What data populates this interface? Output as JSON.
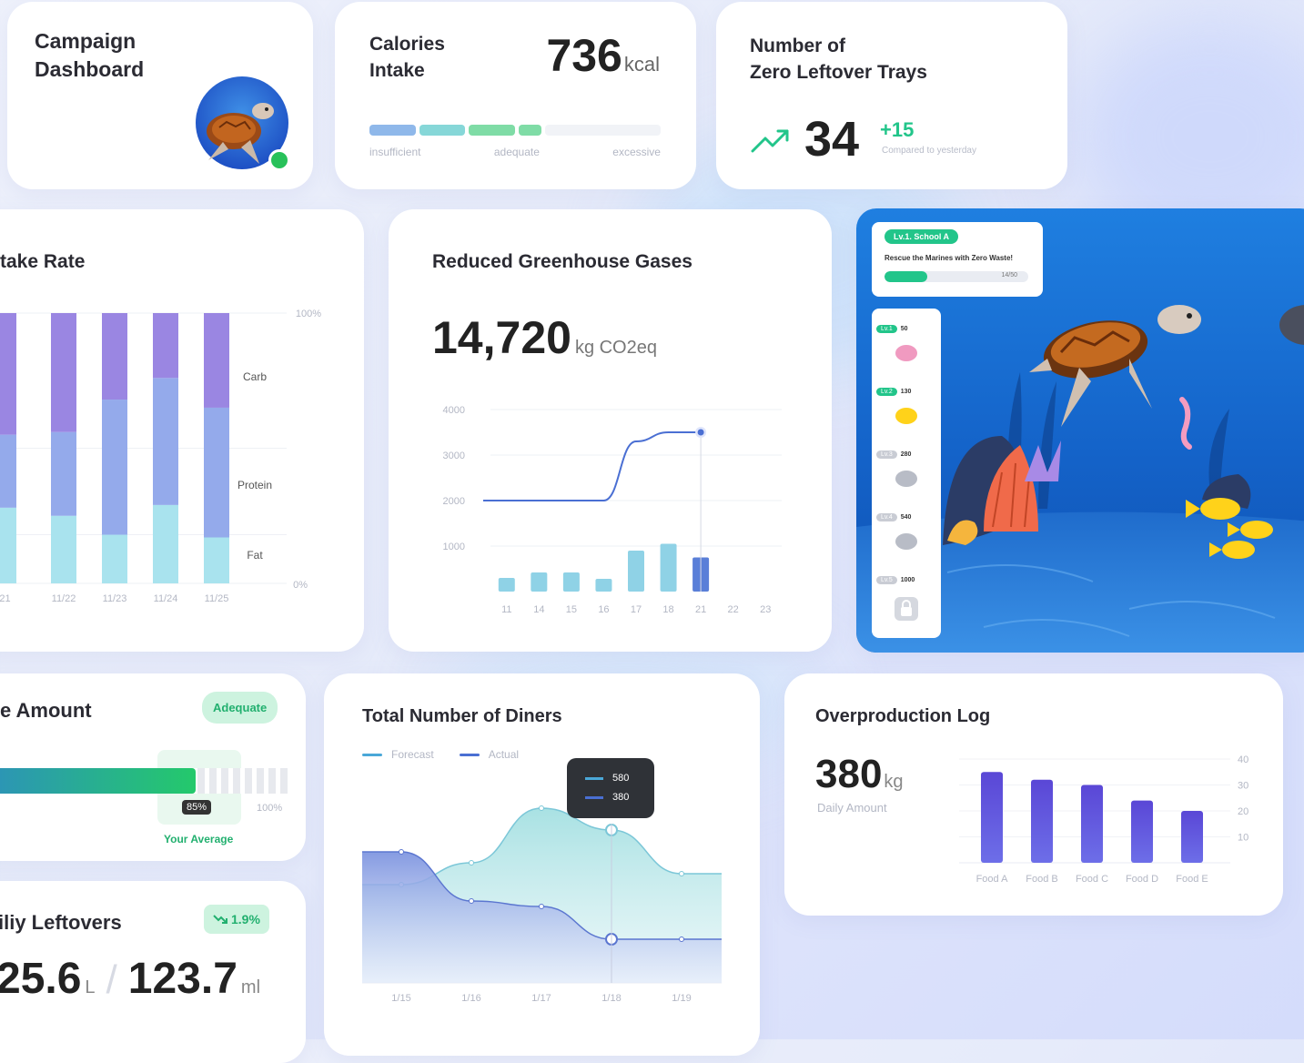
{
  "campaign": {
    "title": "Campaign\nDashboard"
  },
  "calories": {
    "title": "Calories\nIntake",
    "value": "736",
    "unit": "kcal",
    "scale": [
      "insufficient",
      "adequate",
      "excessive"
    ]
  },
  "trays": {
    "title": "Number of\nZero Leftover Trays",
    "value": "34",
    "delta": "+15",
    "delta_note": "Compared to yesterday"
  },
  "intake_rate": {
    "title": "take Rate",
    "y_top": "100%",
    "y_bottom": "0%",
    "segments": [
      "Carb",
      "Protein",
      "Fat"
    ],
    "chart_data": {
      "type": "bar",
      "categories": [
        "/21",
        "11/22",
        "11/23",
        "11/24",
        "11/25"
      ],
      "series": [
        {
          "name": "Fat",
          "values": [
            28,
            25,
            18,
            29,
            17
          ]
        },
        {
          "name": "Protein",
          "values": [
            27,
            31,
            50,
            47,
            48
          ]
        },
        {
          "name": "Carb",
          "values": [
            45,
            44,
            32,
            24,
            35
          ]
        }
      ],
      "ylim": [
        0,
        100
      ]
    }
  },
  "ghg": {
    "title": "Reduced Greenhouse Gases",
    "value": "14,720",
    "unit": "kg CO2eq",
    "chart_data": {
      "type": "bar",
      "categories": [
        "11",
        "14",
        "15",
        "16",
        "17",
        "18",
        "21",
        "22",
        "23"
      ],
      "bars": [
        300,
        420,
        420,
        280,
        900,
        1050,
        750,
        null,
        null
      ],
      "line": [
        2000,
        2000,
        2000,
        2000,
        3300,
        3500,
        3500,
        null,
        null
      ],
      "y_ticks": [
        "4000",
        "3000",
        "2000",
        "1000"
      ],
      "ylim": [
        0,
        4200
      ]
    }
  },
  "game": {
    "badge": "Lv.1. School A",
    "mission": "Rescue the Marines with Zero Waste!",
    "progress": 0.3,
    "progress_label": "14/50",
    "levels": [
      {
        "tag": "Lv.1",
        "value": "50"
      },
      {
        "tag": "Lv.2",
        "value": "130"
      },
      {
        "tag": "Lv.3",
        "value": "280"
      },
      {
        "tag": "Lv.4",
        "value": "540"
      },
      {
        "tag": "Lv.5",
        "value": "1000"
      }
    ]
  },
  "amount": {
    "title": "e Amount",
    "badge": "Adequate",
    "percent": "85%",
    "max": "100%",
    "note": "Your Average",
    "fill": 0.85
  },
  "diners": {
    "title": "Total Number of Diners",
    "legend": [
      "Forecast",
      "Actual"
    ],
    "tooltip": [
      "580",
      "380"
    ],
    "chart_data": {
      "type": "area",
      "x": [
        "1/15",
        "1/16",
        "1/17",
        "1/18",
        "1/19"
      ],
      "series": [
        {
          "name": "Forecast",
          "values": [
            480,
            520,
            620,
            580,
            500
          ]
        },
        {
          "name": "Actual",
          "values": [
            540,
            450,
            440,
            380,
            380
          ]
        }
      ]
    }
  },
  "leftovers": {
    "title": "iliy Leftovers",
    "badge": "1.9%",
    "value1": "25.6",
    "unit1": "L",
    "value2": "123.7",
    "unit2": "ml"
  },
  "overprod": {
    "title": "Overproduction Log",
    "value": "380",
    "unit": "kg",
    "note": "Daily Amount",
    "chart_data": {
      "type": "bar",
      "categories": [
        "Food A",
        "Food B",
        "Food C",
        "Food D",
        "Food E"
      ],
      "values": [
        35,
        32,
        30,
        24,
        20
      ],
      "y_ticks": [
        "40",
        "30",
        "20",
        "10"
      ],
      "ylim": [
        0,
        40
      ]
    }
  }
}
